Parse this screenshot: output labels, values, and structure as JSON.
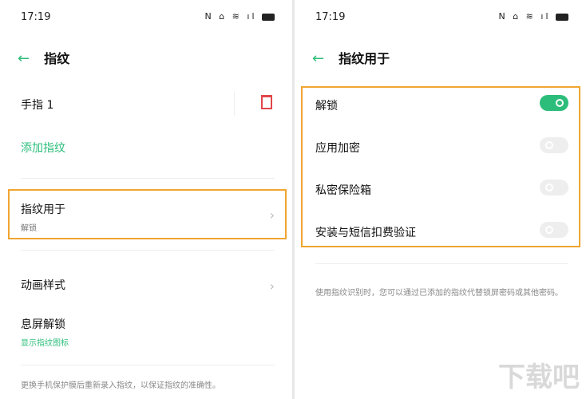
{
  "left": {
    "status": {
      "time": "17:19",
      "icons": "N ⌂ ≋ ıl"
    },
    "title": "指纹",
    "finger": "手指 1",
    "add": "添加指纹",
    "usage": {
      "label": "指纹用于",
      "value": "解锁"
    },
    "animation": "动画样式",
    "screen_off": {
      "label": "息屏解锁",
      "sub": "显示指纹图标"
    },
    "note": "更换手机保护膜后重新录入指纹，以保证指纹的准确性。"
  },
  "right": {
    "status": {
      "time": "17:19",
      "icons": "N ⌂ ≋ ıl"
    },
    "title": "指纹用于",
    "options": [
      {
        "label": "解锁",
        "on": true
      },
      {
        "label": "应用加密",
        "on": false
      },
      {
        "label": "私密保险箱",
        "on": false
      },
      {
        "label": "安装与短信扣费验证",
        "on": false
      }
    ],
    "note": "使用指纹识别时，您可以通过已添加的指纹代替锁屏密码或其他密码。"
  },
  "watermark": "下载吧",
  "colors": {
    "accent": "#2dbd7a",
    "highlight": "#f0a530",
    "delete": "#e0474c"
  }
}
